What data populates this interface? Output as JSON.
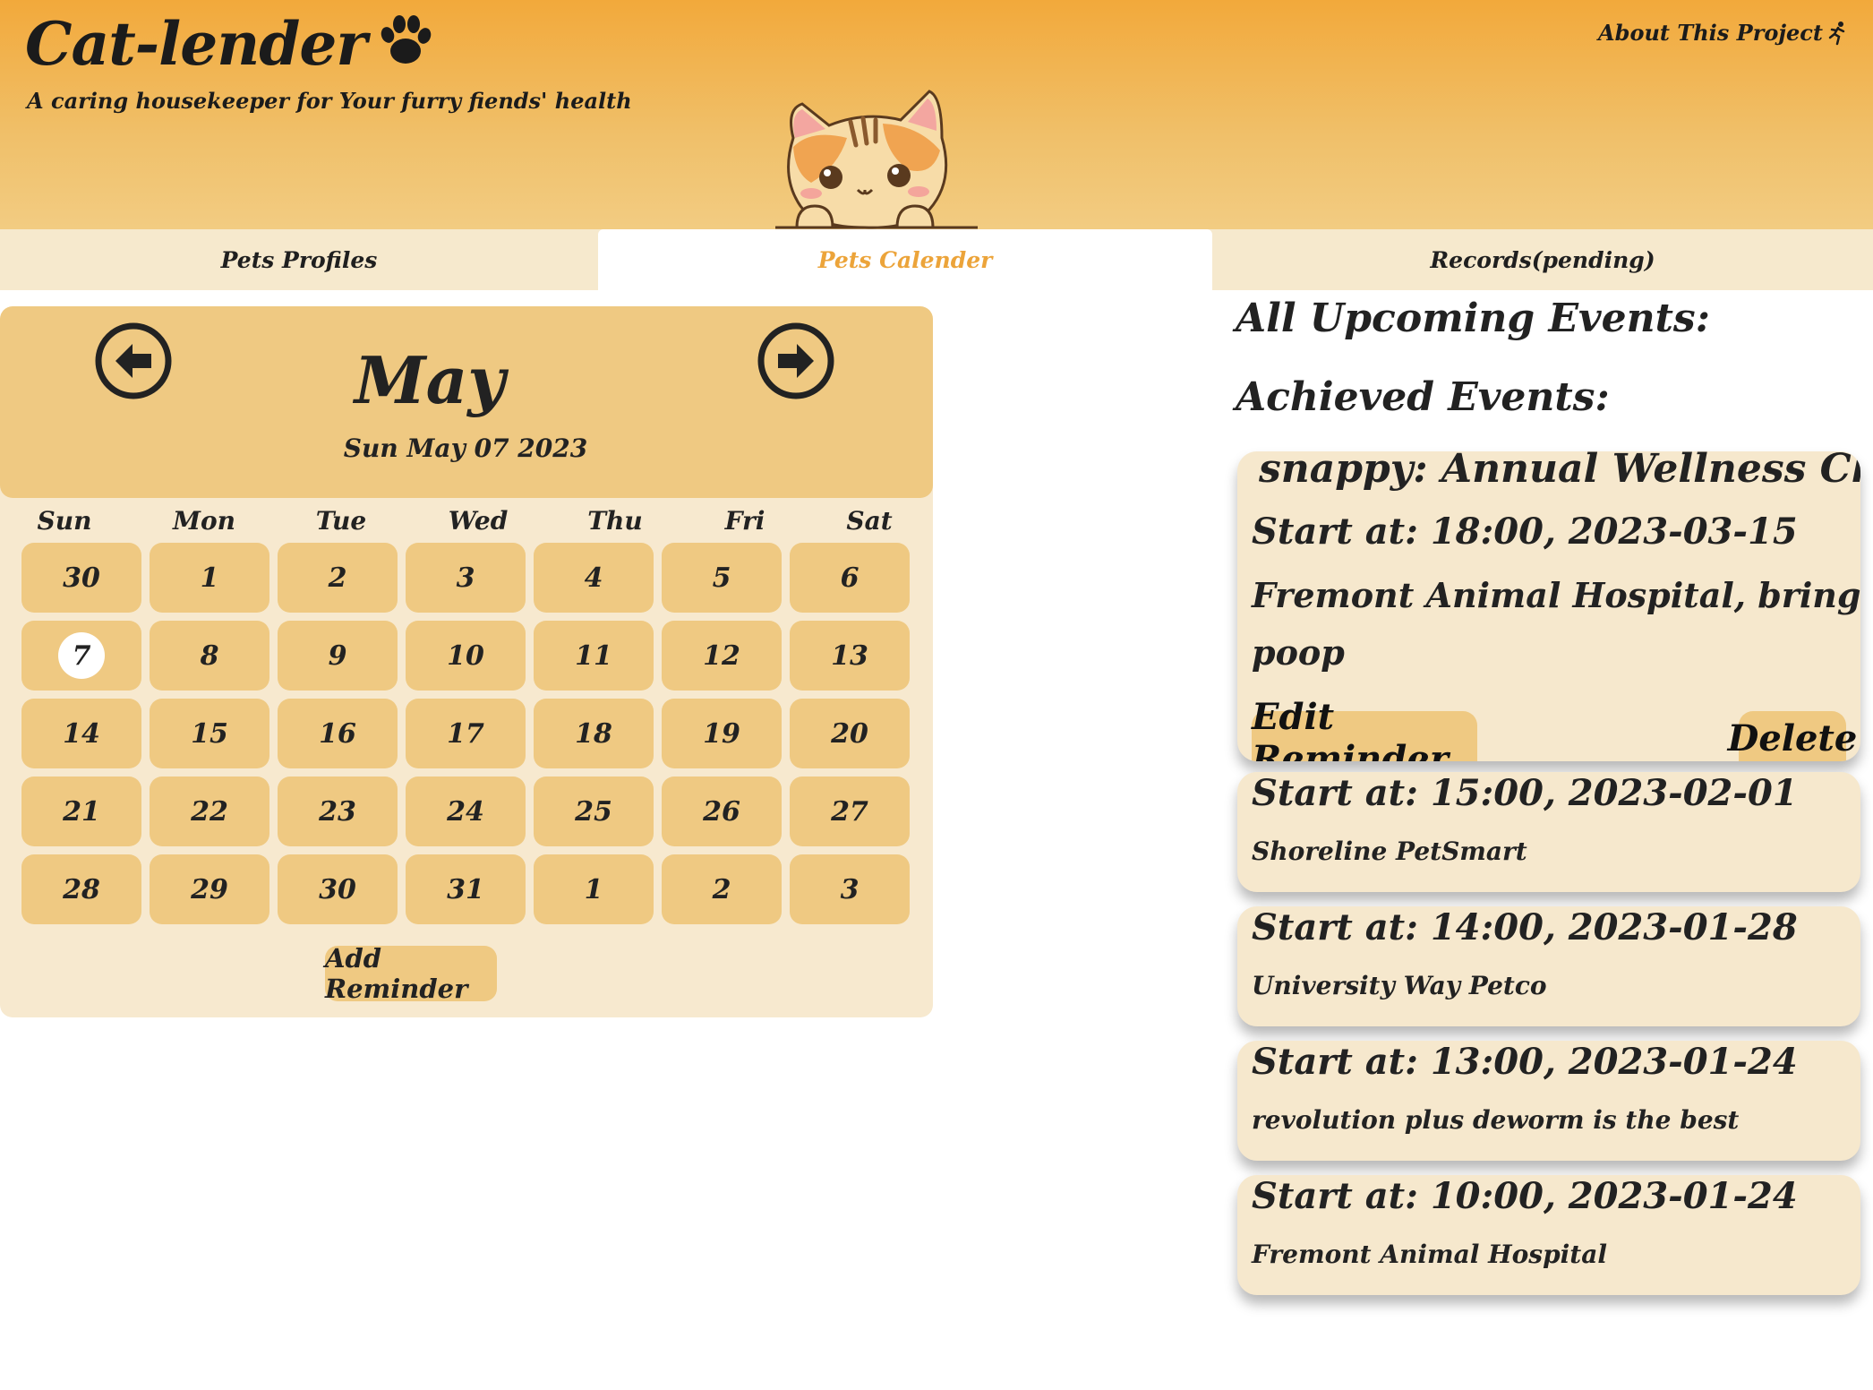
{
  "header": {
    "title": "Cat-lender",
    "subtitle": "A caring housekeeper for Your furry fiends' health",
    "about_link": "About This Project"
  },
  "tabs": [
    {
      "label": "Pets Profiles",
      "active": false
    },
    {
      "label": "Pets Calender",
      "active": true
    },
    {
      "label": "Records(pending)",
      "active": false
    }
  ],
  "calendar": {
    "month": "May",
    "current_date": "Sun May 07 2023",
    "weekdays": [
      "Sun",
      "Mon",
      "Tue",
      "Wed",
      "Thu",
      "Fri",
      "Sat"
    ],
    "weeks": [
      [
        "30",
        "1",
        "2",
        "3",
        "4",
        "5",
        "6"
      ],
      [
        "7",
        "8",
        "9",
        "10",
        "11",
        "12",
        "13"
      ],
      [
        "14",
        "15",
        "16",
        "17",
        "18",
        "19",
        "20"
      ],
      [
        "21",
        "22",
        "23",
        "24",
        "25",
        "26",
        "27"
      ],
      [
        "28",
        "29",
        "30",
        "31",
        "1",
        "2",
        "3"
      ]
    ],
    "selected_day": "7",
    "add_reminder_label": "Add Reminder"
  },
  "events": {
    "upcoming_title": "All Upcoming Events:",
    "achieved_title": "Achieved Events:",
    "expanded": {
      "title": "snappy: Annual Wellness Check",
      "start": "Start at: 18:00, 2023-03-15",
      "note_line1": "Fremont Animal Hospital, brings a little",
      "note_line2": "poop",
      "edit_label": "Edit Reminder",
      "delete_label": "Delete"
    },
    "items": [
      {
        "start": "Start at: 15:00, 2023-02-01",
        "note": "Shoreline PetSmart"
      },
      {
        "start": "Start at: 14:00, 2023-01-28",
        "note": "University Way Petco"
      },
      {
        "start": "Start at: 13:00, 2023-01-24",
        "note": "revolution plus deworm is the best"
      },
      {
        "start": "Start at: 10:00, 2023-01-24",
        "note": "Fremont Animal Hospital"
      }
    ]
  },
  "colors": {
    "header_top": "#f2a93b",
    "accent": "#eca43a",
    "cell": "#efc982",
    "panel": "#f7e9cf"
  },
  "icons": {
    "logo": "paw-icon",
    "about": "runner-icon",
    "prev": "arrow-left-circle-icon",
    "next": "arrow-right-circle-icon"
  }
}
